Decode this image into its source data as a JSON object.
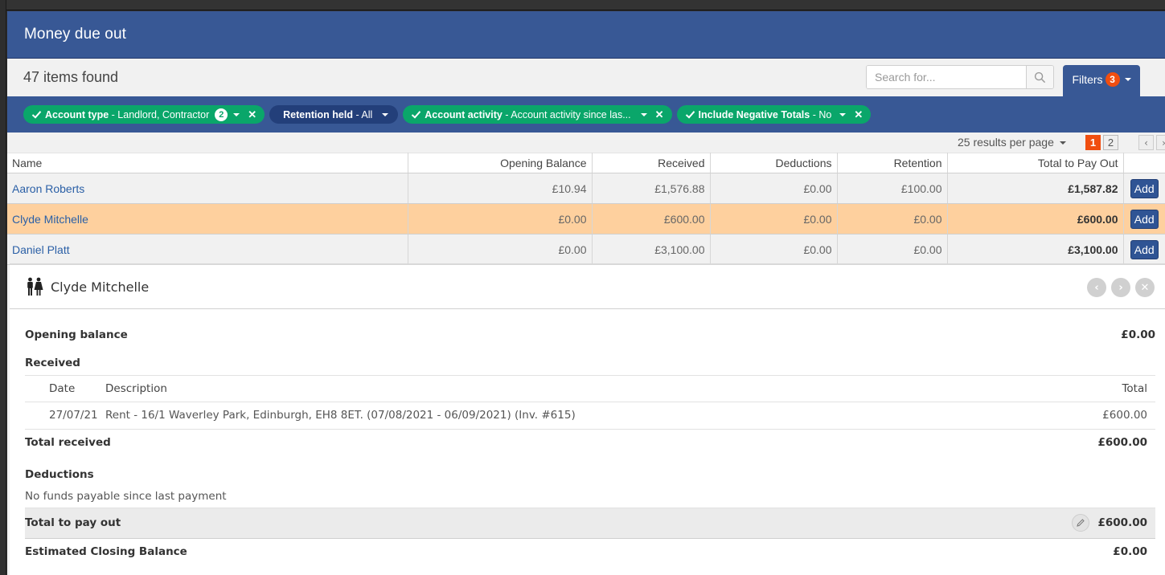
{
  "header": {
    "title": "Money due out"
  },
  "toolbar": {
    "items_found": "47 items found",
    "search_placeholder": "Search for...",
    "filters_label": "Filters",
    "filters_count": "3"
  },
  "filter_chips": [
    {
      "label": "Account type",
      "value": " - Landlord, Contractor",
      "badge": "2",
      "active": true,
      "removable": true
    },
    {
      "label": "Retention held",
      "value": " - All",
      "active": false,
      "removable": false
    },
    {
      "label": "Account activity",
      "value": " - Account activity since las...",
      "active": true,
      "removable": true
    },
    {
      "label": "Include Negative Totals",
      "value": " - No",
      "active": true,
      "removable": true
    }
  ],
  "pagination": {
    "per_page": "25 results per page",
    "pages": [
      "1",
      "2"
    ],
    "current_page": "1"
  },
  "table": {
    "columns": [
      "Name",
      "Opening Balance",
      "Received",
      "Deductions",
      "Retention",
      "Total to Pay Out"
    ],
    "add_label": "Add",
    "rows": [
      {
        "name": "Aaron Roberts",
        "opening_balance": "£10.94",
        "received": "£1,576.88",
        "deductions": "£0.00",
        "retention": "£100.00",
        "total": "£1,587.82",
        "selected": false
      },
      {
        "name": "Clyde Mitchelle",
        "opening_balance": "£0.00",
        "received": "£600.00",
        "deductions": "£0.00",
        "retention": "£0.00",
        "total": "£600.00",
        "selected": true
      },
      {
        "name": "Daniel Platt",
        "opening_balance": "£0.00",
        "received": "£3,100.00",
        "deductions": "£0.00",
        "retention": "£0.00",
        "total": "£3,100.00",
        "selected": false
      }
    ]
  },
  "detail": {
    "name": "Clyde Mitchelle",
    "opening_balance_label": "Opening balance",
    "opening_balance": "£0.00",
    "received_label": "Received",
    "received_columns": [
      "Date",
      "Description",
      "Total"
    ],
    "received_rows": [
      {
        "date": "27/07/21",
        "description": "Rent - 16/1 Waverley Park, Edinburgh, EH8 8ET. (07/08/2021 - 06/09/2021) (Inv. #615)",
        "total": "£600.00"
      }
    ],
    "total_received_label": "Total received",
    "total_received": "£600.00",
    "deductions_label": "Deductions",
    "deductions_message": "No funds payable since last payment",
    "total_to_pay_out_label": "Total to pay out",
    "total_to_pay_out": "£600.00",
    "estimated_closing_label": "Estimated Closing Balance",
    "estimated_closing": "£0.00"
  },
  "colors": {
    "brand_blue": "#385895",
    "chip_green": "#0aa66a",
    "chip_navy": "#233f7a",
    "accent_orange": "#f04e10",
    "selected_row": "#fed09e",
    "link_blue": "#2a5fa6"
  }
}
